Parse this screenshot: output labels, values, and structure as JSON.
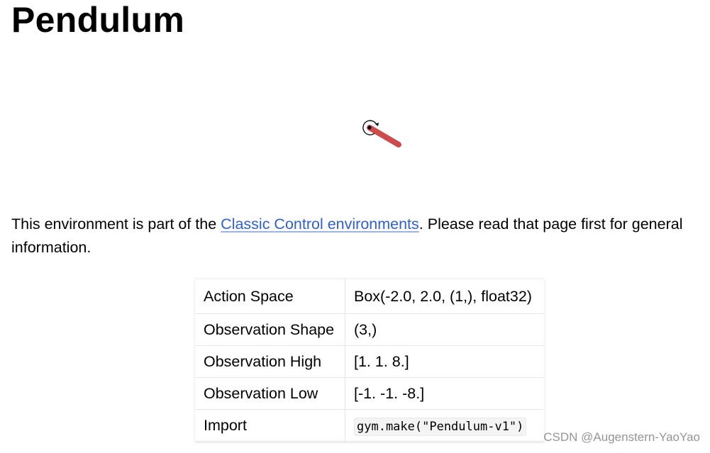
{
  "title": "Pendulum",
  "intro": {
    "before_link": "This environment is part of the ",
    "link_text": "Classic Control environments",
    "after_link": ". Please read that page first for general information."
  },
  "table": {
    "rows": [
      {
        "label": "Action Space",
        "value": "Box(-2.0, 2.0, (1,), float32)"
      },
      {
        "label": "Observation Shape",
        "value": "(3,)"
      },
      {
        "label": "Observation High",
        "value": "[1. 1. 8.]"
      },
      {
        "label": "Observation Low",
        "value": "[-1. -1. -8.]"
      },
      {
        "label": "Import",
        "value": "gym.make(\"Pendulum-v1\")"
      }
    ]
  },
  "colors": {
    "link": "#2f5fd0",
    "pendulum_rod": "#cc4c4c"
  },
  "watermark": "CSDN @Augenstern-YaoYao"
}
